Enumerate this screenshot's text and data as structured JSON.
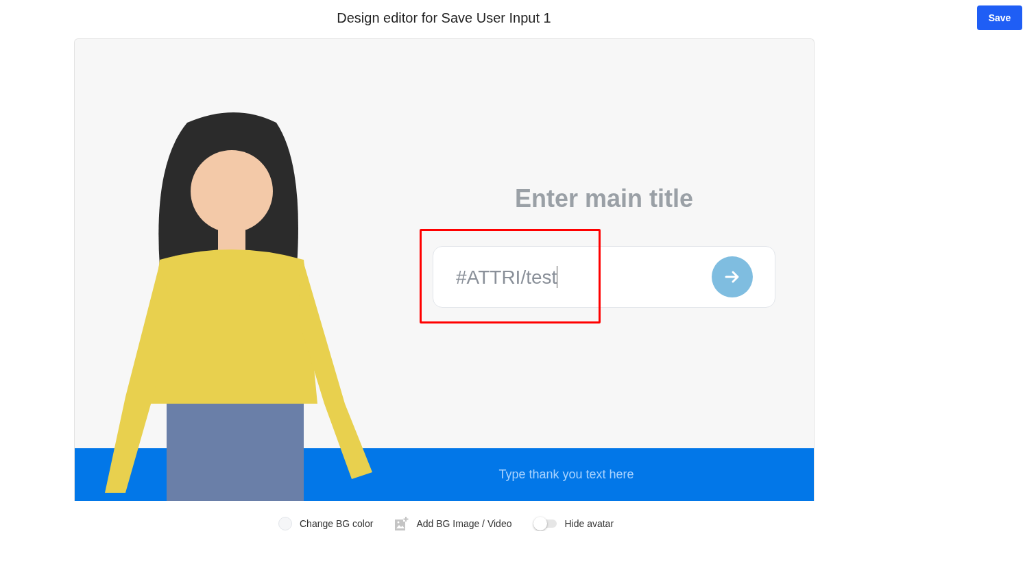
{
  "header": {
    "title": "Design editor for Save User Input 1",
    "save_button": "Save"
  },
  "preview": {
    "title": "Enter main title",
    "input": {
      "value": "#ATTRI/test",
      "highlighted": true
    },
    "thank_you_text": "Type thank you text here"
  },
  "toolbar": [
    {
      "kind": "color",
      "label": "Change BG color"
    },
    {
      "kind": "media",
      "label": "Add BG Image / Video"
    },
    {
      "kind": "toggle",
      "label": "Hide avatar",
      "on": false
    }
  ]
}
